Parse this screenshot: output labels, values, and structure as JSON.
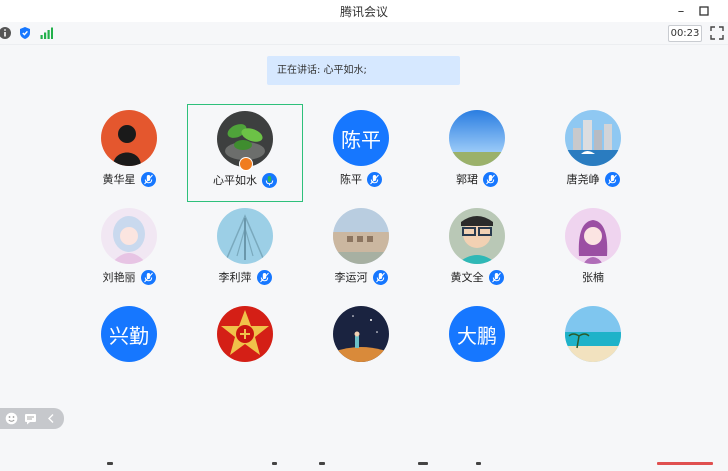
{
  "window": {
    "title": "腾讯会议"
  },
  "toolbar": {
    "timer": "00:23"
  },
  "speaking": {
    "text": "正在讲话: 心平如水;"
  },
  "participants": [
    {
      "name": "黄华星",
      "avatar_text": "",
      "avatar_kind": "silhouette",
      "mic": "muted-blue"
    },
    {
      "name": "心平如水",
      "avatar_text": "",
      "avatar_kind": "leaves",
      "mic": "speaking-green",
      "host": true
    },
    {
      "name": "陈平",
      "avatar_text": "陈平",
      "avatar_kind": "text",
      "mic": "muted-blue"
    },
    {
      "name": "郭珺",
      "avatar_text": "",
      "avatar_kind": "sky",
      "mic": "muted-blue"
    },
    {
      "name": "唐尧峥",
      "avatar_text": "",
      "avatar_kind": "city",
      "mic": "muted-blue"
    },
    {
      "name": "刘艳丽",
      "avatar_text": "",
      "avatar_kind": "anime",
      "mic": "muted-blue"
    },
    {
      "name": "李利萍",
      "avatar_text": "",
      "avatar_kind": "tree",
      "mic": "muted-blue"
    },
    {
      "name": "李运河",
      "avatar_text": "",
      "avatar_kind": "building",
      "mic": "muted-blue"
    },
    {
      "name": "黄文全",
      "avatar_text": "",
      "avatar_kind": "kid",
      "mic": "muted-blue"
    },
    {
      "name": "张楠",
      "avatar_text": "",
      "avatar_kind": "portrait",
      "mic": "none"
    },
    {
      "name": "",
      "avatar_text": "兴勤",
      "avatar_kind": "text",
      "mic": "none"
    },
    {
      "name": "",
      "avatar_text": "",
      "avatar_kind": "emblem",
      "mic": "none"
    },
    {
      "name": "",
      "avatar_text": "",
      "avatar_kind": "night",
      "mic": "none"
    },
    {
      "name": "",
      "avatar_text": "大鹏",
      "avatar_kind": "text",
      "mic": "none"
    },
    {
      "name": "",
      "avatar_text": "",
      "avatar_kind": "beach",
      "mic": "none"
    }
  ],
  "colors": {
    "accent": "#1677ff",
    "active_border": "#2ec07b",
    "speaking_mic": "#27b45e",
    "banner_bg": "#d6e8ff"
  }
}
